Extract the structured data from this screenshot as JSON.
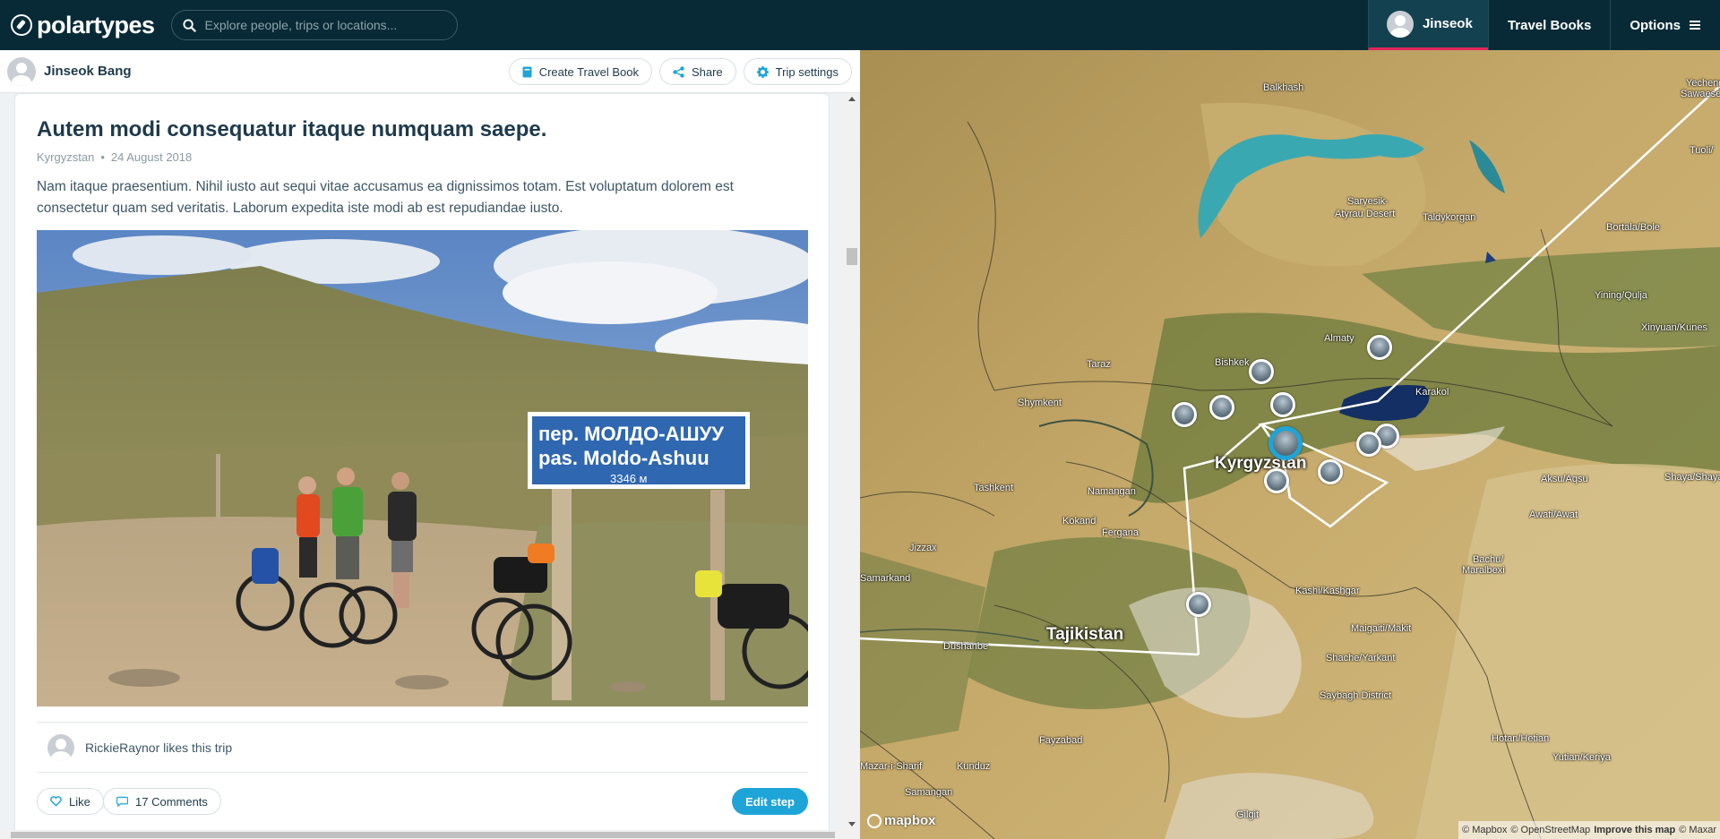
{
  "app": {
    "name": "polartypes",
    "search_placeholder": "Explore people, trips or locations...",
    "nav": {
      "user": "Jinseok",
      "travel_books": "Travel Books",
      "options": "Options"
    }
  },
  "trip_header": {
    "owner": "Jinseok Bang",
    "actions": {
      "create_travel_book": "Create Travel Book",
      "share": "Share",
      "trip_settings": "Trip settings"
    }
  },
  "step": {
    "title": "Autem modi consequatur itaque numquam saepe.",
    "location": "Kyrgyzstan",
    "separator": "•",
    "date": "24 August 2018",
    "text": "Nam itaque praesentium. Nihil iusto aut sequi vitae accusamus ea dignissimos totam. Est voluptatum dolorem est consectetur quam sed veritatis. Laborum expedita iste modi ab est repudiandae iusto.",
    "photo_sign": {
      "line1": "пер. МОЛДО-АШУУ",
      "line2": "pas. Moldo-Ashuu",
      "line3": "3346 м"
    },
    "likes_text": "RickieRaynor likes this trip",
    "like_label": "Like",
    "comments_label": "17 Comments",
    "edit_label": "Edit step"
  },
  "map": {
    "countries": {
      "kyrgyzstan": "Kyrgyzstan",
      "tajikistan": "Tajikistan"
    },
    "places": {
      "balkhash": "Balkhash",
      "saryesik": "Saryesik-",
      "saryesik2": "Atyrau Desert",
      "taldykorgan": "Taldykorgan",
      "bortala": "Bortala/Bole",
      "yining": "Yining/Qulja",
      "xinyuan": "Xinyuan/Kunes",
      "taraz": "Taraz",
      "shymkent": "Shymkent",
      "bishkek": "Bishkek",
      "almaty": "Almaty",
      "karakol": "Karakol",
      "tashkent": "Tashkent",
      "namangan": "Namangan",
      "kokand": "Kokand",
      "fergana": "Fergana",
      "jizzax": "Jizzax",
      "samarkand": "Samarkand",
      "aksu": "Aksu/Aqsu",
      "awati": "Awati/Awat",
      "shaya": "Shaya/Shayar",
      "bachu": "Bachu/",
      "maralbexi": "Maralbexi",
      "kashi": "Kashi/Kashgar",
      "maigaiti": "Maigaiti/Makit",
      "shache": "Shache/Yarkant",
      "dushanbe": "Dushanbe",
      "yecheng": "Yecheng/",
      "sawaesek": "Sawaesek",
      "tuoli": "Tuoli/",
      "saybagh": "Saybagh District",
      "fayzabad": "Fayzabad",
      "kunduz": "Kunduz",
      "mazar": "Mazar-i-Sharif",
      "samangan": "Samangan",
      "hotan": "Hotan/Hetian",
      "yutian": "Yutian/Keriya",
      "gilgit": "Gilgit"
    },
    "mapbox": "mapbox",
    "attribution": {
      "mapbox": "© Mapbox",
      "osm": "© OpenStreetMap",
      "improve": "Improve this map",
      "maxar": "© Maxar"
    }
  },
  "colors": {
    "nav_bg": "#072a36",
    "accent": "#1fa4d8",
    "user_underline": "#e3245a"
  }
}
